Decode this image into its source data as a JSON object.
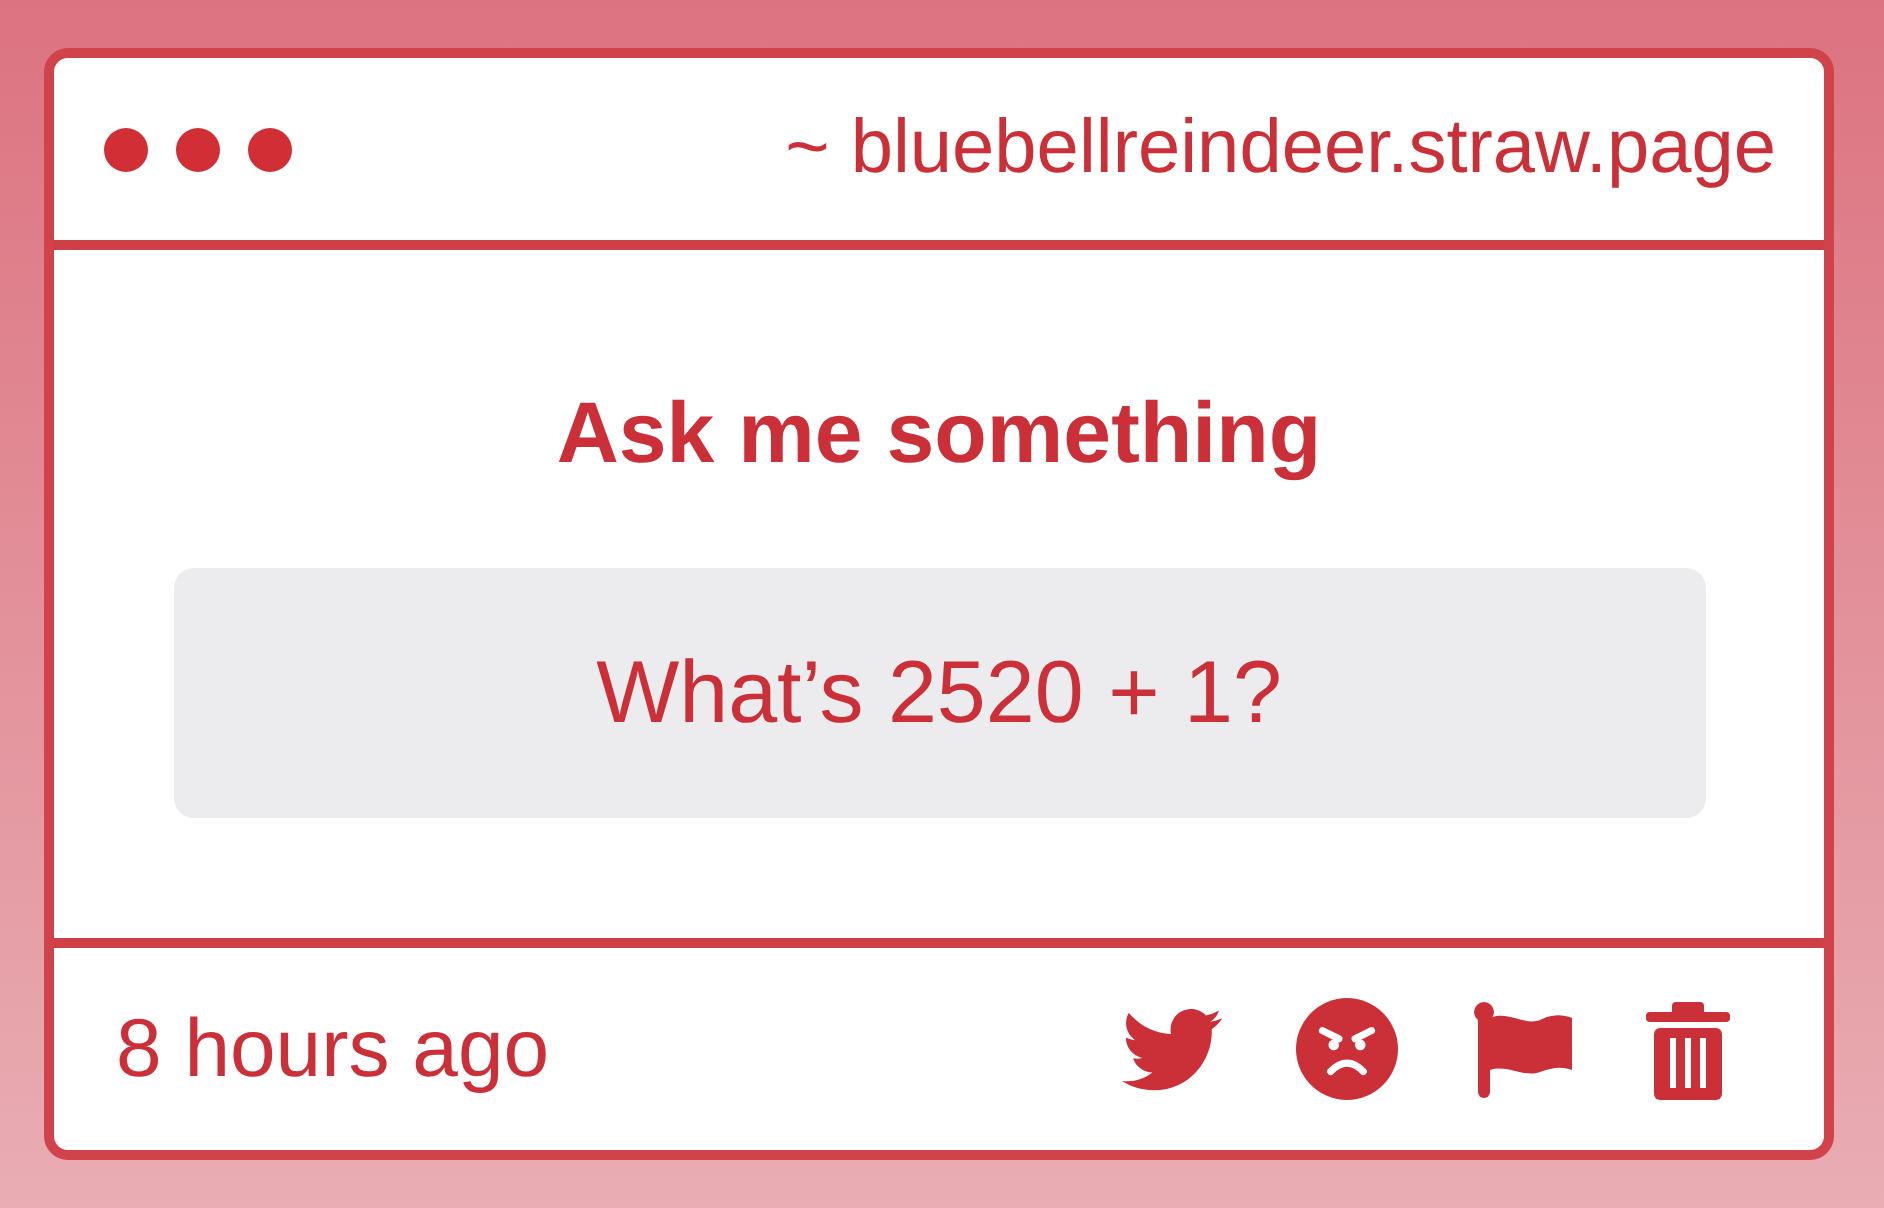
{
  "window": {
    "title": "~ bluebellreindeer.straw.page"
  },
  "question": {
    "heading": "Ask me something",
    "text": "What’s 2520 + 1?"
  },
  "footer": {
    "timestamp": "8 hours ago",
    "actions": [
      {
        "kind": "tweet"
      },
      {
        "kind": "block"
      },
      {
        "kind": "report"
      },
      {
        "kind": "delete"
      }
    ]
  }
}
